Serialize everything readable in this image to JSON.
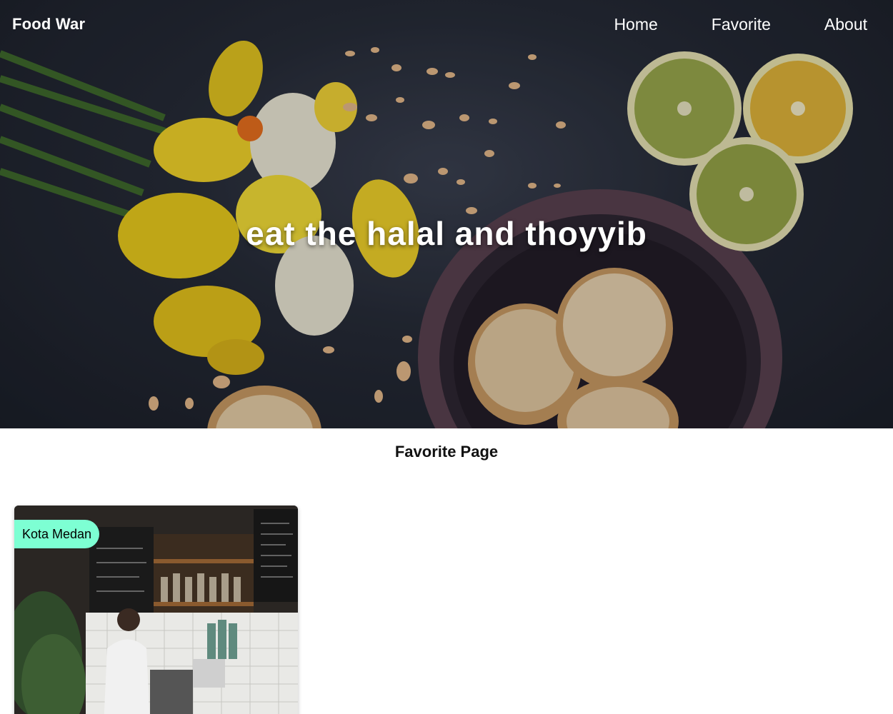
{
  "navbar": {
    "brand": "Food War",
    "links": [
      {
        "label": "Home"
      },
      {
        "label": "Favorite"
      },
      {
        "label": "About"
      }
    ]
  },
  "hero": {
    "tagline": "eat the halal and thoyyib"
  },
  "favorites": {
    "title": "Favorite Page",
    "restaurants": [
      {
        "city": "Kota Medan"
      }
    ]
  },
  "colors": {
    "badge": "#7dffd3",
    "hero_bg": "#262b37",
    "text_on_hero": "#ffffff"
  }
}
